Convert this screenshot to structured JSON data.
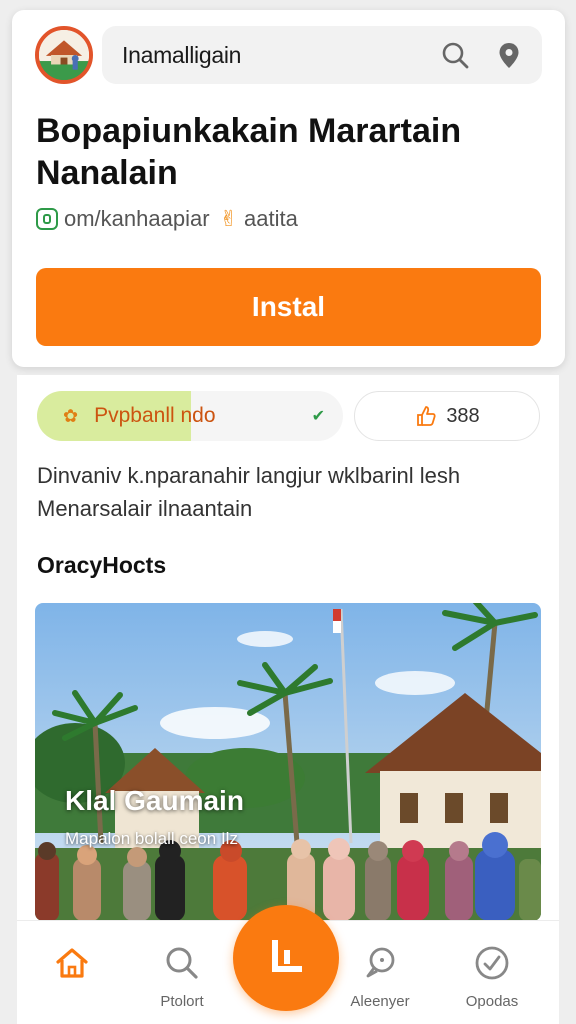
{
  "header": {
    "search_text": "Inamalligain",
    "icons": [
      "app-logo-icon",
      "search-icon",
      "location-pin-icon"
    ]
  },
  "app": {
    "title": "Bopapiunkakain Marartain Nanalain",
    "developer": "om/kanhaapiar",
    "badge": "aatita",
    "install_label": "Instal"
  },
  "chips": {
    "category": "Pvpbanll ndo",
    "count": "388"
  },
  "description": "Dinvaniv k.nparanahir langjur wklbarinl lesh Menarsalair ilnaantain",
  "section": {
    "title": "OracyHocts",
    "featured_title": "Klal Gaumain",
    "featured_subtitle": "Mapalon bolall ceon Ilz"
  },
  "nav": {
    "home_label": "",
    "search_label": "Ptolort",
    "messenger_label": "Aleenyer",
    "options_label": "Opodas"
  },
  "colors": {
    "accent": "#fa7a10",
    "green": "#2e9a48",
    "chip_green": "#d9ec9e"
  }
}
